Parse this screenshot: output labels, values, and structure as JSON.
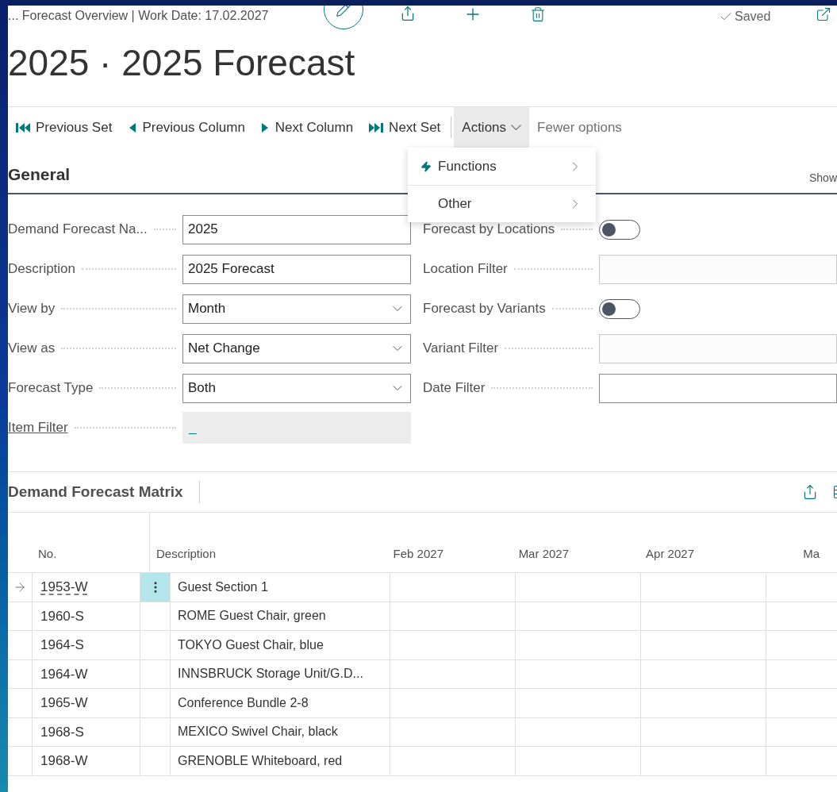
{
  "header": {
    "breadcrumb": "... Forecast Overview | Work Date: 17.02.2027",
    "status": "Saved"
  },
  "title": "2025 · 2025 Forecast",
  "action_bar": [
    {
      "label": "Previous Set",
      "kind": "prev-set"
    },
    {
      "label": "Previous Column",
      "kind": "prev"
    },
    {
      "label": "Next Column",
      "kind": "next"
    },
    {
      "label": "Next Set",
      "kind": "next-set"
    },
    {
      "label": "Actions",
      "kind": "menu",
      "expanded": true
    },
    {
      "label": "Fewer options",
      "kind": "plain"
    }
  ],
  "actions_menu": [
    {
      "label": "Functions",
      "kind": "functions"
    },
    {
      "label": "Other",
      "kind": "plain"
    }
  ],
  "general": {
    "title": "General",
    "show_link": "Show",
    "left_fields": [
      {
        "label": "Demand Forecast Na...",
        "kind": "text",
        "value": "2025"
      },
      {
        "label": "Description",
        "kind": "text",
        "value": "2025 Forecast"
      },
      {
        "label": "View by",
        "kind": "select",
        "value": "Month"
      },
      {
        "label": "View as",
        "kind": "select",
        "value": "Net Change"
      },
      {
        "label": "Forecast Type",
        "kind": "select",
        "value": "Both"
      },
      {
        "label": "Item Filter",
        "kind": "link",
        "value": "_"
      }
    ],
    "right_fields": [
      {
        "label": "Forecast by Locations",
        "kind": "toggle",
        "on": false
      },
      {
        "label": "Location Filter",
        "kind": "lookup"
      },
      {
        "label": "Forecast by Variants",
        "kind": "toggle",
        "on": false
      },
      {
        "label": "Variant Filter",
        "kind": "lookup"
      },
      {
        "label": "Date Filter",
        "kind": "text"
      }
    ]
  },
  "matrix": {
    "title": "Demand Forecast Matrix",
    "columns": [
      "No.",
      "Description",
      "Feb 2027",
      "Mar 2027",
      "Apr 2027",
      "Ma"
    ],
    "rows": [
      {
        "no": "1953-W",
        "description": "Guest Section 1",
        "selected": true
      },
      {
        "no": "1960-S",
        "description": "ROME Guest Chair, green",
        "selected": false
      },
      {
        "no": "1964-S",
        "description": "TOKYO Guest Chair, blue",
        "selected": false
      },
      {
        "no": "1964-W",
        "description": "INNSBRUCK Storage Unit/G.D...",
        "selected": false
      },
      {
        "no": "1965-W",
        "description": "Conference Bundle 2-8",
        "selected": false
      },
      {
        "no": "1968-S",
        "description": "MEXICO Swivel Chair, black",
        "selected": false
      },
      {
        "no": "1968-W",
        "description": "GRENOBLE Whiteboard, red",
        "selected": false
      }
    ]
  }
}
